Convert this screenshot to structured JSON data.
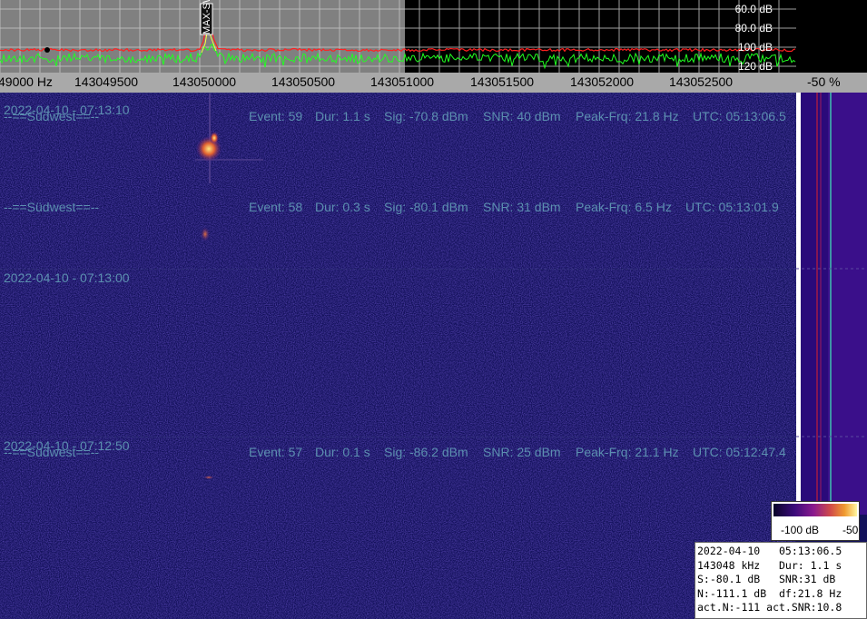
{
  "spectrum": {
    "db_labels": [
      "60.0 dB",
      "80.0 dB",
      "100 dB",
      "120 dB"
    ],
    "station_marker": "MAX-SW",
    "colors": {
      "background_left": "#808080",
      "background_right": "#000000",
      "peak_trace": "#ff2020",
      "live_trace": "#20ff20",
      "grid": "#c8c8c8"
    }
  },
  "freq_axis": {
    "ticks": [
      "49000 Hz",
      "143049500",
      "143050000",
      "143050500",
      "143051000",
      "143051500",
      "143052000",
      "143052500"
    ]
  },
  "pct_panel": {
    "label": "-50 %"
  },
  "waterfall": {
    "rows": [
      {
        "timestamp": "2022-04-10 - 07:13:10",
        "station": "--==Südwest==--",
        "event": "Event: 59",
        "dur": "Dur: 1.1 s",
        "sig": "Sig: -70.8 dBm",
        "snr": "SNR: 40 dBm",
        "peak": "Peak-Frq: 21.8 Hz",
        "utc": "UTC: 05:13:06.5"
      },
      {
        "timestamp": "",
        "station": "--==Südwest==--",
        "event": "Event: 58",
        "dur": "Dur: 0.3 s",
        "sig": "Sig: -80.1 dBm",
        "snr": "SNR: 31 dBm",
        "peak": "Peak-Frq: 6.5 Hz",
        "utc": "UTC: 05:13:01.9"
      },
      {
        "timestamp": "2022-04-10 - 07:13:00",
        "station": "",
        "event": "",
        "dur": "",
        "sig": "",
        "snr": "",
        "peak": "",
        "utc": ""
      },
      {
        "timestamp": "2022-04-10 - 07:12:50",
        "station": "--==Südwest==--",
        "event": "Event: 57",
        "dur": "Dur: 0.1 s",
        "sig": "Sig: -86.2 dBm",
        "snr": "SNR: 25 dBm",
        "peak": "Peak-Frq: 21.1 Hz",
        "utc": "UTC: 05:12:47.4"
      }
    ],
    "colors": {
      "background": "#12105a",
      "text": "#5c8fb0"
    }
  },
  "colorbar": {
    "min_label": "-100 dB",
    "max_label": "-50"
  },
  "infobox": {
    "rows": [
      "2022-04-10   05:13:06.5",
      "143048 kHz   Dur: 1.1 s",
      "S:-80.1 dB   SNR:31 dB",
      "N:-111.1 dB  df:21.8 Hz",
      "act.N:-111 act.SNR:10.8"
    ]
  }
}
